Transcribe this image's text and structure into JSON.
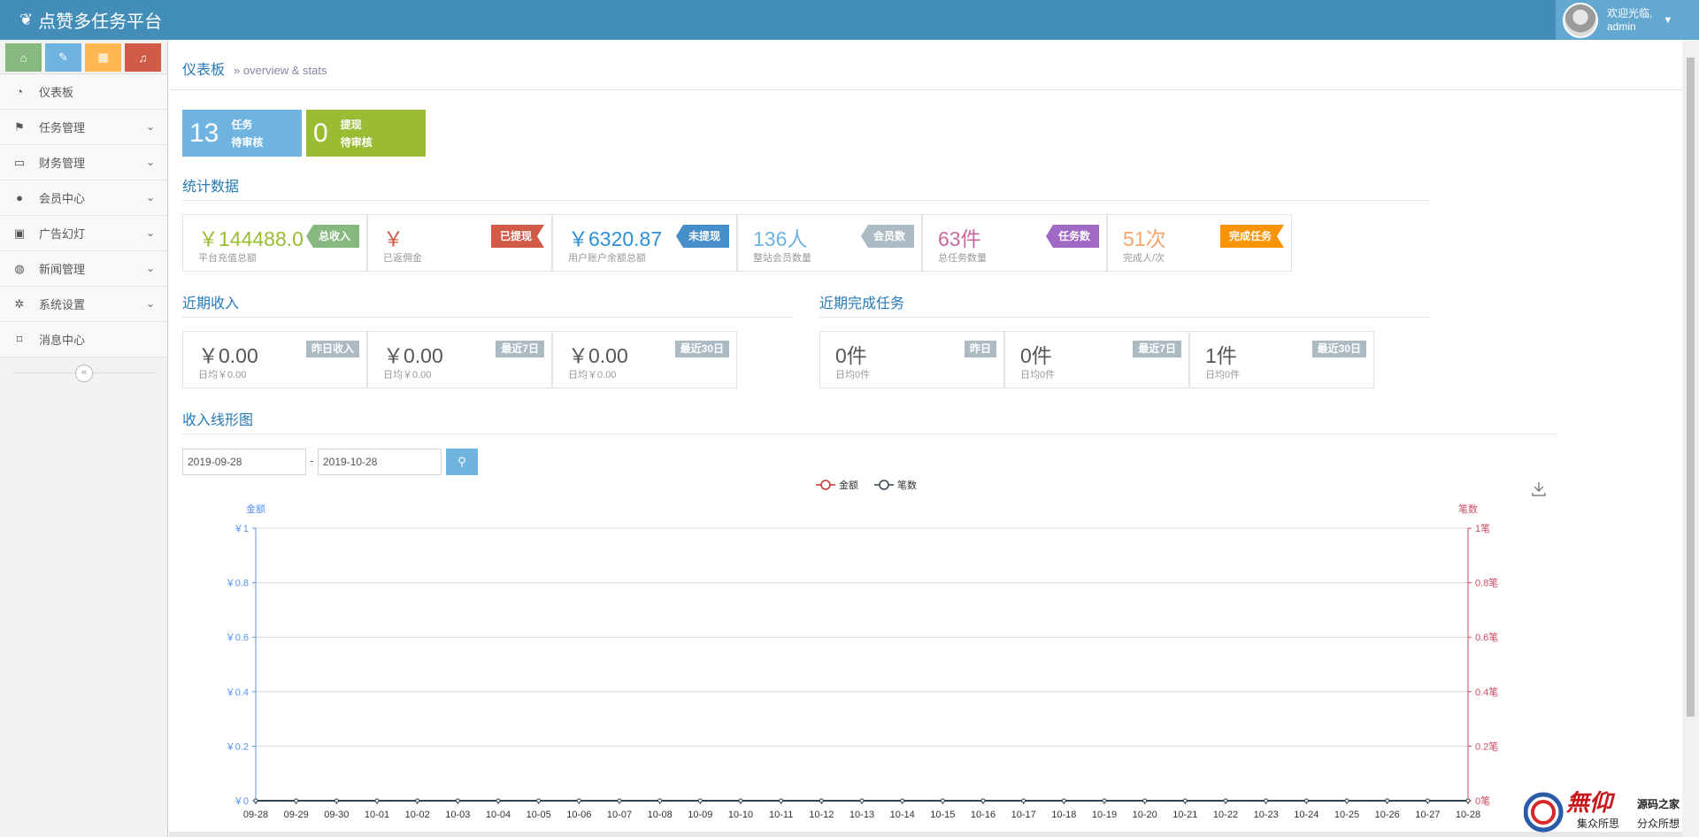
{
  "navbar": {
    "brand": "点赞多任务平台",
    "welcome": "欢迎光临,",
    "username": "admin"
  },
  "sidebar": {
    "items": [
      {
        "label": "仪表板",
        "icon": "dashboard-icon",
        "glyph": "◔",
        "has_children": false
      },
      {
        "label": "任务管理",
        "icon": "flag-icon",
        "glyph": "⚑",
        "has_children": true
      },
      {
        "label": "财务管理",
        "icon": "inbox-icon",
        "glyph": "▭",
        "has_children": true
      },
      {
        "label": "会员中心",
        "icon": "user-icon",
        "glyph": "●",
        "has_children": true
      },
      {
        "label": "广告幻灯",
        "icon": "picture-icon",
        "glyph": "▣",
        "has_children": true
      },
      {
        "label": "新闻管理",
        "icon": "globe-icon",
        "glyph": "◍",
        "has_children": true
      },
      {
        "label": "系统设置",
        "icon": "cog-icon",
        "glyph": "✲",
        "has_children": true
      },
      {
        "label": "消息中心",
        "icon": "bookmark-icon",
        "glyph": "⌑",
        "has_children": false
      }
    ]
  },
  "breadcrumb": {
    "title": "仪表板",
    "subtitle": "» overview & stats"
  },
  "pending": [
    {
      "num": "13",
      "line1": "任务",
      "line2": "待审核",
      "color": "#6fb3e0"
    },
    {
      "num": "0",
      "line1": "提现",
      "line2": "待审核",
      "color": "#9abc32"
    }
  ],
  "stats": {
    "title": "统计数据",
    "boxes": [
      {
        "value": "￥144488.0",
        "sub": "平台充值总额",
        "tag": "总收入",
        "color": "#9abc32",
        "tag_color": "#87b87f"
      },
      {
        "value": "￥",
        "sub": "已返佣金",
        "tag": "已提现",
        "color": "#d15b47",
        "tag_color": "#d15b47"
      },
      {
        "value": "￥6320.87",
        "sub": "用户账户余额总额",
        "tag": "未提现",
        "color": "#2a91d8",
        "tag_color": "#478fca"
      },
      {
        "value": "136人",
        "sub": "整站会员数量",
        "tag": "会员数",
        "color": "#6fb3e0",
        "tag_color": "#abbac3"
      },
      {
        "value": "63件",
        "sub": "总任务数量",
        "tag": "任务数",
        "color": "#c6699f",
        "tag_color": "#a069c3"
      },
      {
        "value": "51次",
        "sub": "完成人/次",
        "tag": "完成任务",
        "color": "#f4a56b",
        "tag_color": "#f89406"
      }
    ]
  },
  "recent_income": {
    "title": "近期收入",
    "boxes": [
      {
        "value": "￥0.00",
        "sub": "日均￥0.00",
        "tag": "昨日收入"
      },
      {
        "value": "￥0.00",
        "sub": "日均￥0.00",
        "tag": "最近7日"
      },
      {
        "value": "￥0.00",
        "sub": "日均￥0.00",
        "tag": "最近30日"
      }
    ]
  },
  "recent_tasks": {
    "title": "近期完成任务",
    "boxes": [
      {
        "value": "0件",
        "sub": "日均0件",
        "tag": "昨日"
      },
      {
        "value": "0件",
        "sub": "日均0件",
        "tag": "最近7日"
      },
      {
        "value": "1件",
        "sub": "日均0件",
        "tag": "最近30日"
      }
    ]
  },
  "income_chart": {
    "title": "收入线形图",
    "date_from": "2019-09-28",
    "date_sep": "-",
    "date_to": "2019-10-28"
  },
  "watermark": {
    "logo": "無仰",
    "line1": "源码之家",
    "line2a": "集众所思",
    "line2b": "分众所想"
  },
  "chart_data": {
    "type": "line",
    "x": [
      "09-28",
      "09-29",
      "09-30",
      "10-01",
      "10-02",
      "10-03",
      "10-04",
      "10-05",
      "10-06",
      "10-07",
      "10-08",
      "10-09",
      "10-10",
      "10-11",
      "10-12",
      "10-13",
      "10-14",
      "10-15",
      "10-16",
      "10-17",
      "10-18",
      "10-19",
      "10-20",
      "10-21",
      "10-22",
      "10-23",
      "10-24",
      "10-25",
      "10-26",
      "10-27",
      "10-28"
    ],
    "series": [
      {
        "name": "金额",
        "axis": "left",
        "color": "#c23531",
        "values": [
          0,
          0,
          0,
          0,
          0,
          0,
          0,
          0,
          0,
          0,
          0,
          0,
          0,
          0,
          0,
          0,
          0,
          0,
          0,
          0,
          0,
          0,
          0,
          0,
          0,
          0,
          0,
          0,
          0,
          0,
          0
        ]
      },
      {
        "name": "笔数",
        "axis": "right",
        "color": "#2f4554",
        "values": [
          0,
          0,
          0,
          0,
          0,
          0,
          0,
          0,
          0,
          0,
          0,
          0,
          0,
          0,
          0,
          0,
          0,
          0,
          0,
          0,
          0,
          0,
          0,
          0,
          0,
          0,
          0,
          0,
          0,
          0,
          0
        ]
      }
    ],
    "yleft": {
      "label": "金额",
      "ticks": [
        "￥0",
        "￥0.2",
        "￥0.4",
        "￥0.6",
        "￥0.8",
        "￥1"
      ],
      "min": 0,
      "max": 1,
      "color": "#5793f3"
    },
    "yright": {
      "label": "笔数",
      "ticks": [
        "0笔",
        "0.2笔",
        "0.4笔",
        "0.6笔",
        "0.8笔",
        "1笔"
      ],
      "min": 0,
      "max": 1,
      "color": "#d14a61"
    },
    "legend_position": "top-center",
    "grid": true
  }
}
